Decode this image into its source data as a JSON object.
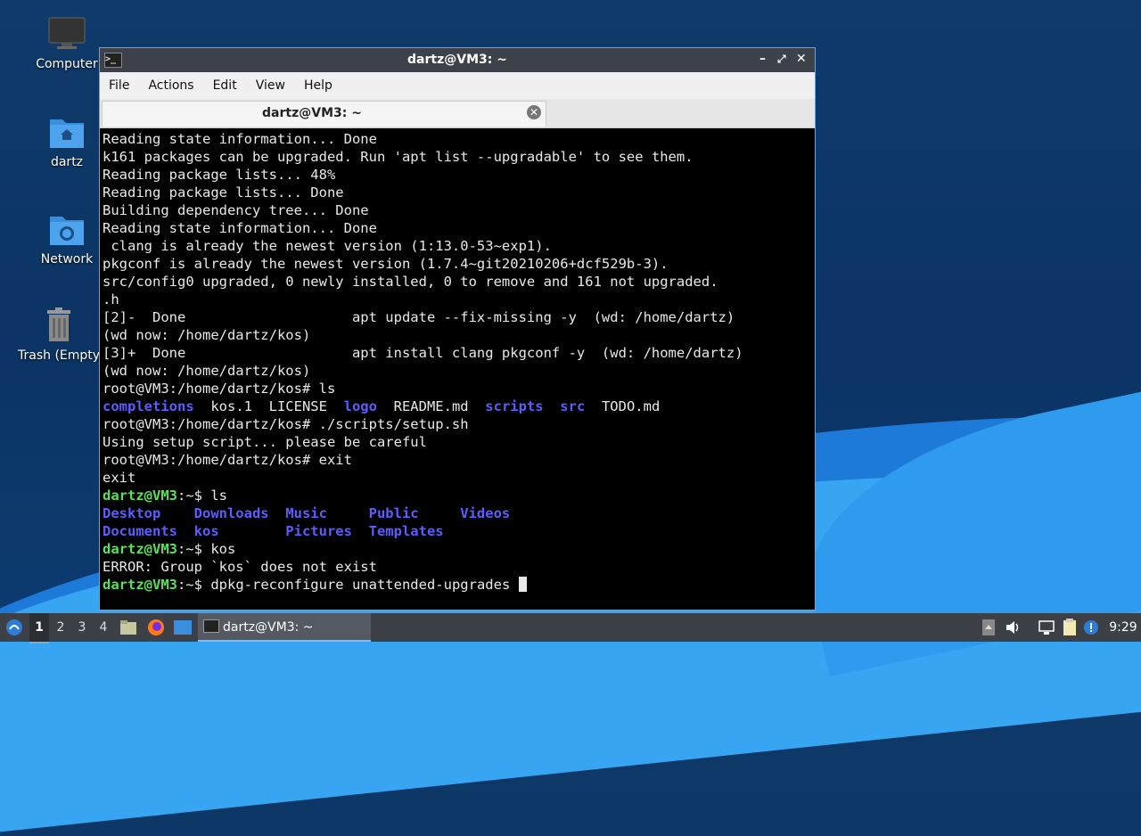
{
  "desktop": {
    "icons": [
      {
        "label": "Computer",
        "icon": "monitor-icon"
      },
      {
        "label": "dartz",
        "icon": "home-folder-icon"
      },
      {
        "label": "Network",
        "icon": "network-folder-icon"
      },
      {
        "label": "Trash (Empty)",
        "icon": "trash-icon"
      }
    ]
  },
  "window": {
    "title": "dartz@VM3: ~",
    "controls": {
      "minimize": "–",
      "maximize": "⤢",
      "close": "✕"
    },
    "menu": [
      "File",
      "Actions",
      "Edit",
      "View",
      "Help"
    ],
    "tab_label": "dartz@VM3: ~"
  },
  "terminal": {
    "lines": [
      "Reading state information... Done",
      "k161 packages can be upgraded. Run 'apt list --upgradable' to see them.",
      "Reading package lists... 48%",
      "Reading package lists... Done",
      "Building dependency tree... Done",
      "Reading state information... Done",
      " clang is already the newest version (1:13.0-53~exp1).",
      "pkgconf is already the newest version (1.7.4~git20210206+dcf529b-3).",
      "src/config0 upgraded, 0 newly installed, 0 to remove and 161 not upgraded.",
      ".h",
      "[2]-  Done                    apt update --fix-missing -y  (wd: /home/dartz)",
      "(wd now: /home/dartz/kos)",
      "[3]+  Done                    apt install clang pkgconf -y  (wd: /home/dartz)",
      "(wd now: /home/dartz/kos)",
      "root@VM3:/home/dartz/kos# ls"
    ],
    "ls_kos": [
      {
        "t": "completions",
        "dir": true
      },
      {
        "t": "  kos.1  LICENSE  ",
        "dir": false
      },
      {
        "t": "logo",
        "dir": true
      },
      {
        "t": "  README.md  ",
        "dir": false
      },
      {
        "t": "scripts",
        "dir": true
      },
      {
        "t": "  ",
        "dir": false
      },
      {
        "t": "src",
        "dir": true
      },
      {
        "t": "  TODO.md",
        "dir": false
      }
    ],
    "lines2": [
      "root@VM3:/home/dartz/kos# ./scripts/setup.sh",
      "Using setup script... please be careful",
      "root@VM3:/home/dartz/kos# exit",
      "exit"
    ],
    "prompt": "dartz@VM3",
    "prompt_path": ":~$ ",
    "cmd1": "ls",
    "ls_home_row1": "Desktop    Downloads  Music     Public     Videos",
    "ls_home_row2": "Documents  kos        Pictures  Templates",
    "cmd2": "kos",
    "error": "ERROR: Group `kos` does not exist",
    "cmd3": "dpkg-reconfigure unattended-upgrades "
  },
  "taskbar": {
    "workspaces": [
      "1",
      "2",
      "3",
      "4"
    ],
    "active_workspace": "1",
    "task_label": "dartz@VM3: ~",
    "clock": "9:29"
  },
  "colors": {
    "terminal_bg": "#000000",
    "directory": "#5c5cff",
    "prompt": "#5be05b",
    "taskbar": "#3d4047"
  }
}
